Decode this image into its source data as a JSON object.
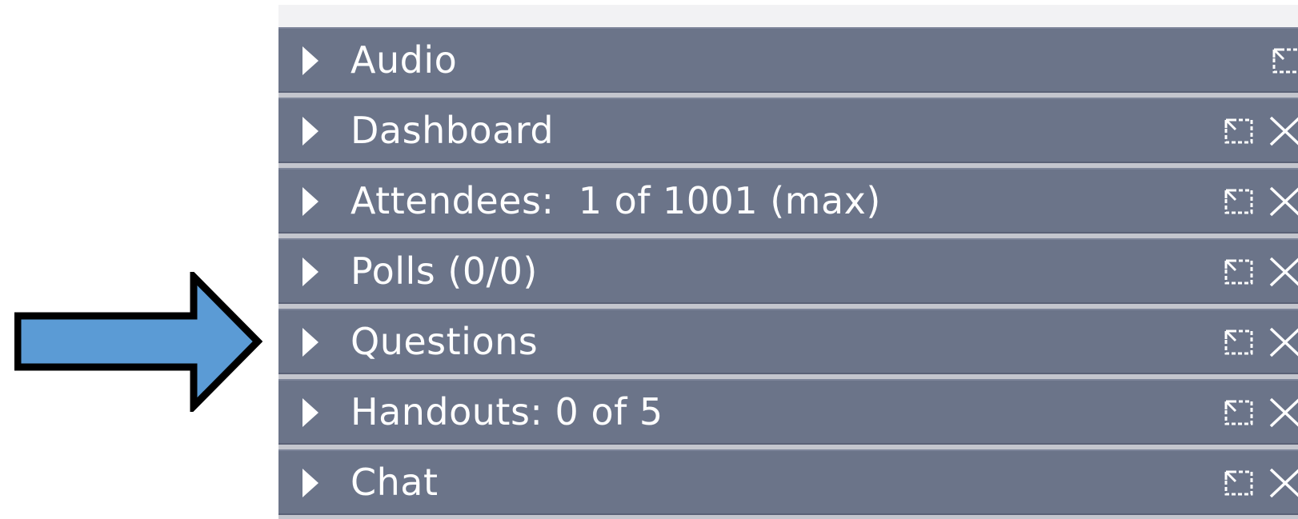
{
  "panels": [
    {
      "label": "Audio",
      "has_close": false
    },
    {
      "label": "Dashboard",
      "has_close": true
    },
    {
      "label": "Attendees:  1 of 1001 (max)",
      "has_close": true
    },
    {
      "label": "Polls (0/0)",
      "has_close": true
    },
    {
      "label": "Questions",
      "has_close": true
    },
    {
      "label": "Handouts: 0 of 5",
      "has_close": true
    },
    {
      "label": "Chat",
      "has_close": true
    }
  ],
  "colors": {
    "panel_bg": "#6b7489",
    "panel_text": "#ffffff",
    "arrow_fill": "#5b9bd5",
    "arrow_stroke": "#000000"
  },
  "icons": {
    "expand": "triangle-right-icon",
    "popout": "popout-icon",
    "close": "close-x-icon",
    "callout": "right-arrow-callout-icon"
  }
}
